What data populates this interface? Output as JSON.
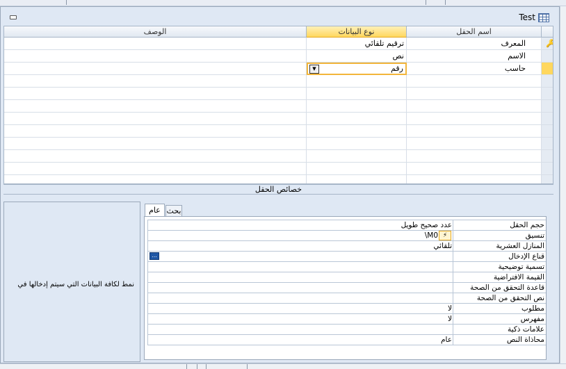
{
  "window": {
    "title": "Test"
  },
  "grid": {
    "headers": {
      "field_name": "اسم الحقل",
      "data_type": "نوع البيانات",
      "description": "الوصف"
    },
    "rows": [
      {
        "name": "المعرف",
        "type": "ترقيم تلقائي",
        "desc": "",
        "primary_key": true
      },
      {
        "name": "الاسم",
        "type": "نص",
        "desc": ""
      },
      {
        "name": "حاسب",
        "type": "رقم",
        "desc": "",
        "current": true
      }
    ]
  },
  "field_properties": {
    "header": "خصائص الحقل",
    "tabs": {
      "general": "عام",
      "lookup": "بحث"
    },
    "help_text": "نمط لكافة البيانات التي سيتم إدخالها في",
    "props": [
      {
        "label": "حجم الحقل",
        "value": "عدد صحيح طويل"
      },
      {
        "label": "تنسيق",
        "value": "\\M0"
      },
      {
        "label": "المنازل العشرية",
        "value": "تلقائي"
      },
      {
        "label": "قناع الإدخال",
        "value": ""
      },
      {
        "label": "تسمية توضيحية",
        "value": ""
      },
      {
        "label": "القيمة الافتراضية",
        "value": ""
      },
      {
        "label": "قاعدة التحقق من الصحة",
        "value": ""
      },
      {
        "label": "نص التحقق من الصحة",
        "value": ""
      },
      {
        "label": "مطلوب",
        "value": "لا"
      },
      {
        "label": "مفهرس",
        "value": "لا"
      },
      {
        "label": "علامات ذكية",
        "value": ""
      },
      {
        "label": "محاذاة النص",
        "value": "عام"
      }
    ],
    "input_mask_button": "..."
  },
  "icons": {
    "key": "key-icon",
    "table": "table-icon",
    "dropdown": "dropdown-arrow-icon",
    "format_builder": "lightning-icon"
  },
  "colors": {
    "accent": "#ffd75e",
    "border": "#9aa8ba",
    "panel": "#dfe8f4"
  }
}
